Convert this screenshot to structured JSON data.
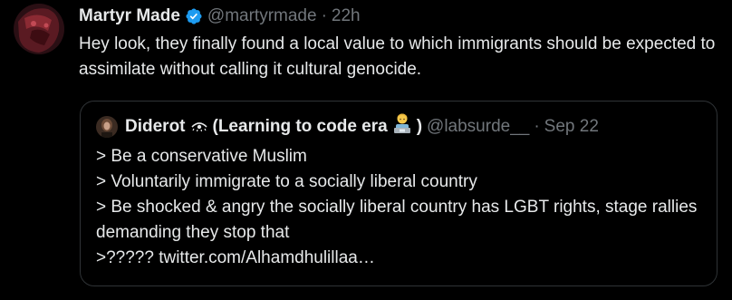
{
  "tweet": {
    "author_name": "Martyr Made",
    "handle": "@martyrmade",
    "separator": "·",
    "time": "22h",
    "text": "Hey look, they finally found a local value to which immigrants should be expected to assimilate without calling it cultural genocide."
  },
  "quoted": {
    "author_name": "Diderot",
    "emoji_label_start": "(Learning to code era",
    "emoji_label_end": ")",
    "handle": "@labsurde__",
    "separator": "·",
    "date": "Sep 22",
    "lines": [
      "> Be a conservative Muslim",
      "> Voluntarily immigrate to a socially liberal country",
      "> Be shocked & angry the socially liberal country has LGBT rights, stage rallies demanding they stop that",
      ">????? twitter.com/Alhamdhulillaa…"
    ]
  },
  "colors": {
    "background": "#000000",
    "text": "#e7e9ea",
    "muted": "#71767b",
    "border": "#2f3336",
    "verified": "#1d9bf0"
  },
  "icons": [
    "verified-badge-icon",
    "eye-symbol-icon",
    "technologist-emoji-icon"
  ]
}
